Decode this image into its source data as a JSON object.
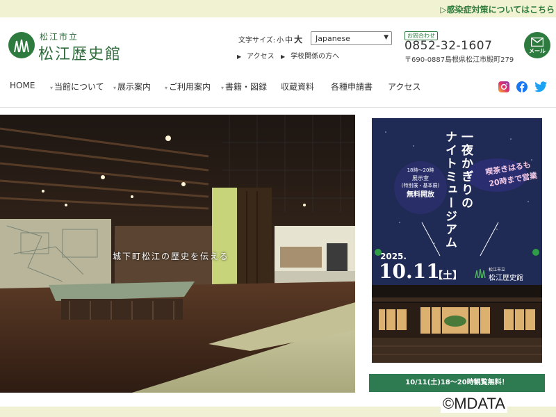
{
  "top_notice": "▷感染症対策についてはこちら",
  "header": {
    "logo_small": "松江市立",
    "logo_big": "松江歴史館",
    "font_size_label": "文字サイズ:",
    "font_size_options": [
      "小",
      "中",
      "大"
    ],
    "language_selected": "Japanese",
    "links": [
      {
        "label": "アクセス"
      },
      {
        "label": "学校関係の方へ"
      }
    ],
    "contact_badge": "お問合わせ",
    "phone": "0852-32-1607",
    "address": "〒690-0887島根県松江市殿町279",
    "mail_label": "メール"
  },
  "nav": {
    "items": [
      {
        "label": "HOME",
        "dropdown": false
      },
      {
        "label": "当館について",
        "dropdown": true
      },
      {
        "label": "展示案内",
        "dropdown": true
      },
      {
        "label": "ご利用案内",
        "dropdown": true
      },
      {
        "label": "書籍・図録",
        "dropdown": true
      },
      {
        "label": "収蔵資料",
        "dropdown": false
      },
      {
        "label": "各種申請書",
        "dropdown": false
      },
      {
        "label": "アクセス",
        "dropdown": false
      }
    ],
    "social": [
      "instagram-icon",
      "facebook-icon",
      "twitter-icon"
    ]
  },
  "hero": {
    "caption": "城下町松江の歴史を伝える"
  },
  "event": {
    "title_line1": "一夜かぎりの",
    "title_line2": "ナイトミュージアム",
    "tea_line1": "喫茶きはるも",
    "tea_line2": "20時まで営業",
    "hours": "18時～20時",
    "room": "展示室",
    "room_note": "(特別展・基本展)",
    "free": "無料開放",
    "year": "2025.",
    "date": "10.11",
    "day_of_week": "【土】",
    "logo_small": "松江市立",
    "logo_name": "松江歴史館",
    "button_label": "10/11(土)18～20時観覧無料！"
  },
  "copyright": "©MDATA",
  "colors": {
    "brand_green": "#2e7b3f",
    "poster_navy": "#1f2a55",
    "banner_bg": "#f1f2d2"
  }
}
